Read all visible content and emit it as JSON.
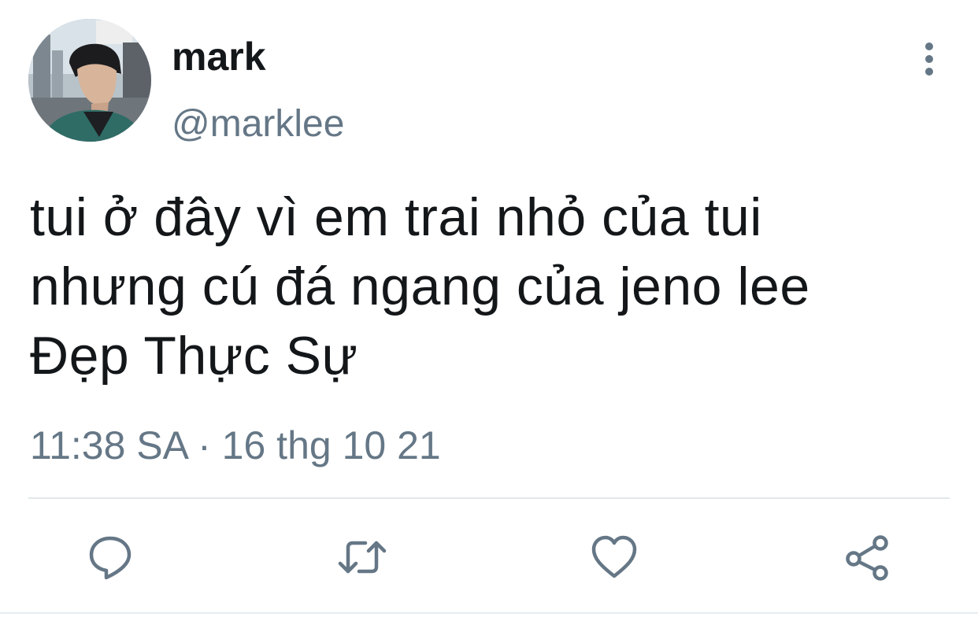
{
  "tweet": {
    "author": {
      "display_name": "mark",
      "handle": "@marklee"
    },
    "text_lines": [
      "tui ở đây vì em trai nhỏ của tui",
      "nhưng cú đá ngang của jeno lee",
      "Đẹp Thực Sự"
    ],
    "timestamp": "11:38 SA · 16 thg 10 21"
  },
  "actions": [
    {
      "icon": "reply-icon"
    },
    {
      "icon": "retweet-icon"
    },
    {
      "icon": "like-icon"
    },
    {
      "icon": "share-icon"
    }
  ],
  "colors": {
    "text": "#14171a",
    "secondary": "#657786",
    "divider": "#e1e8ed"
  }
}
